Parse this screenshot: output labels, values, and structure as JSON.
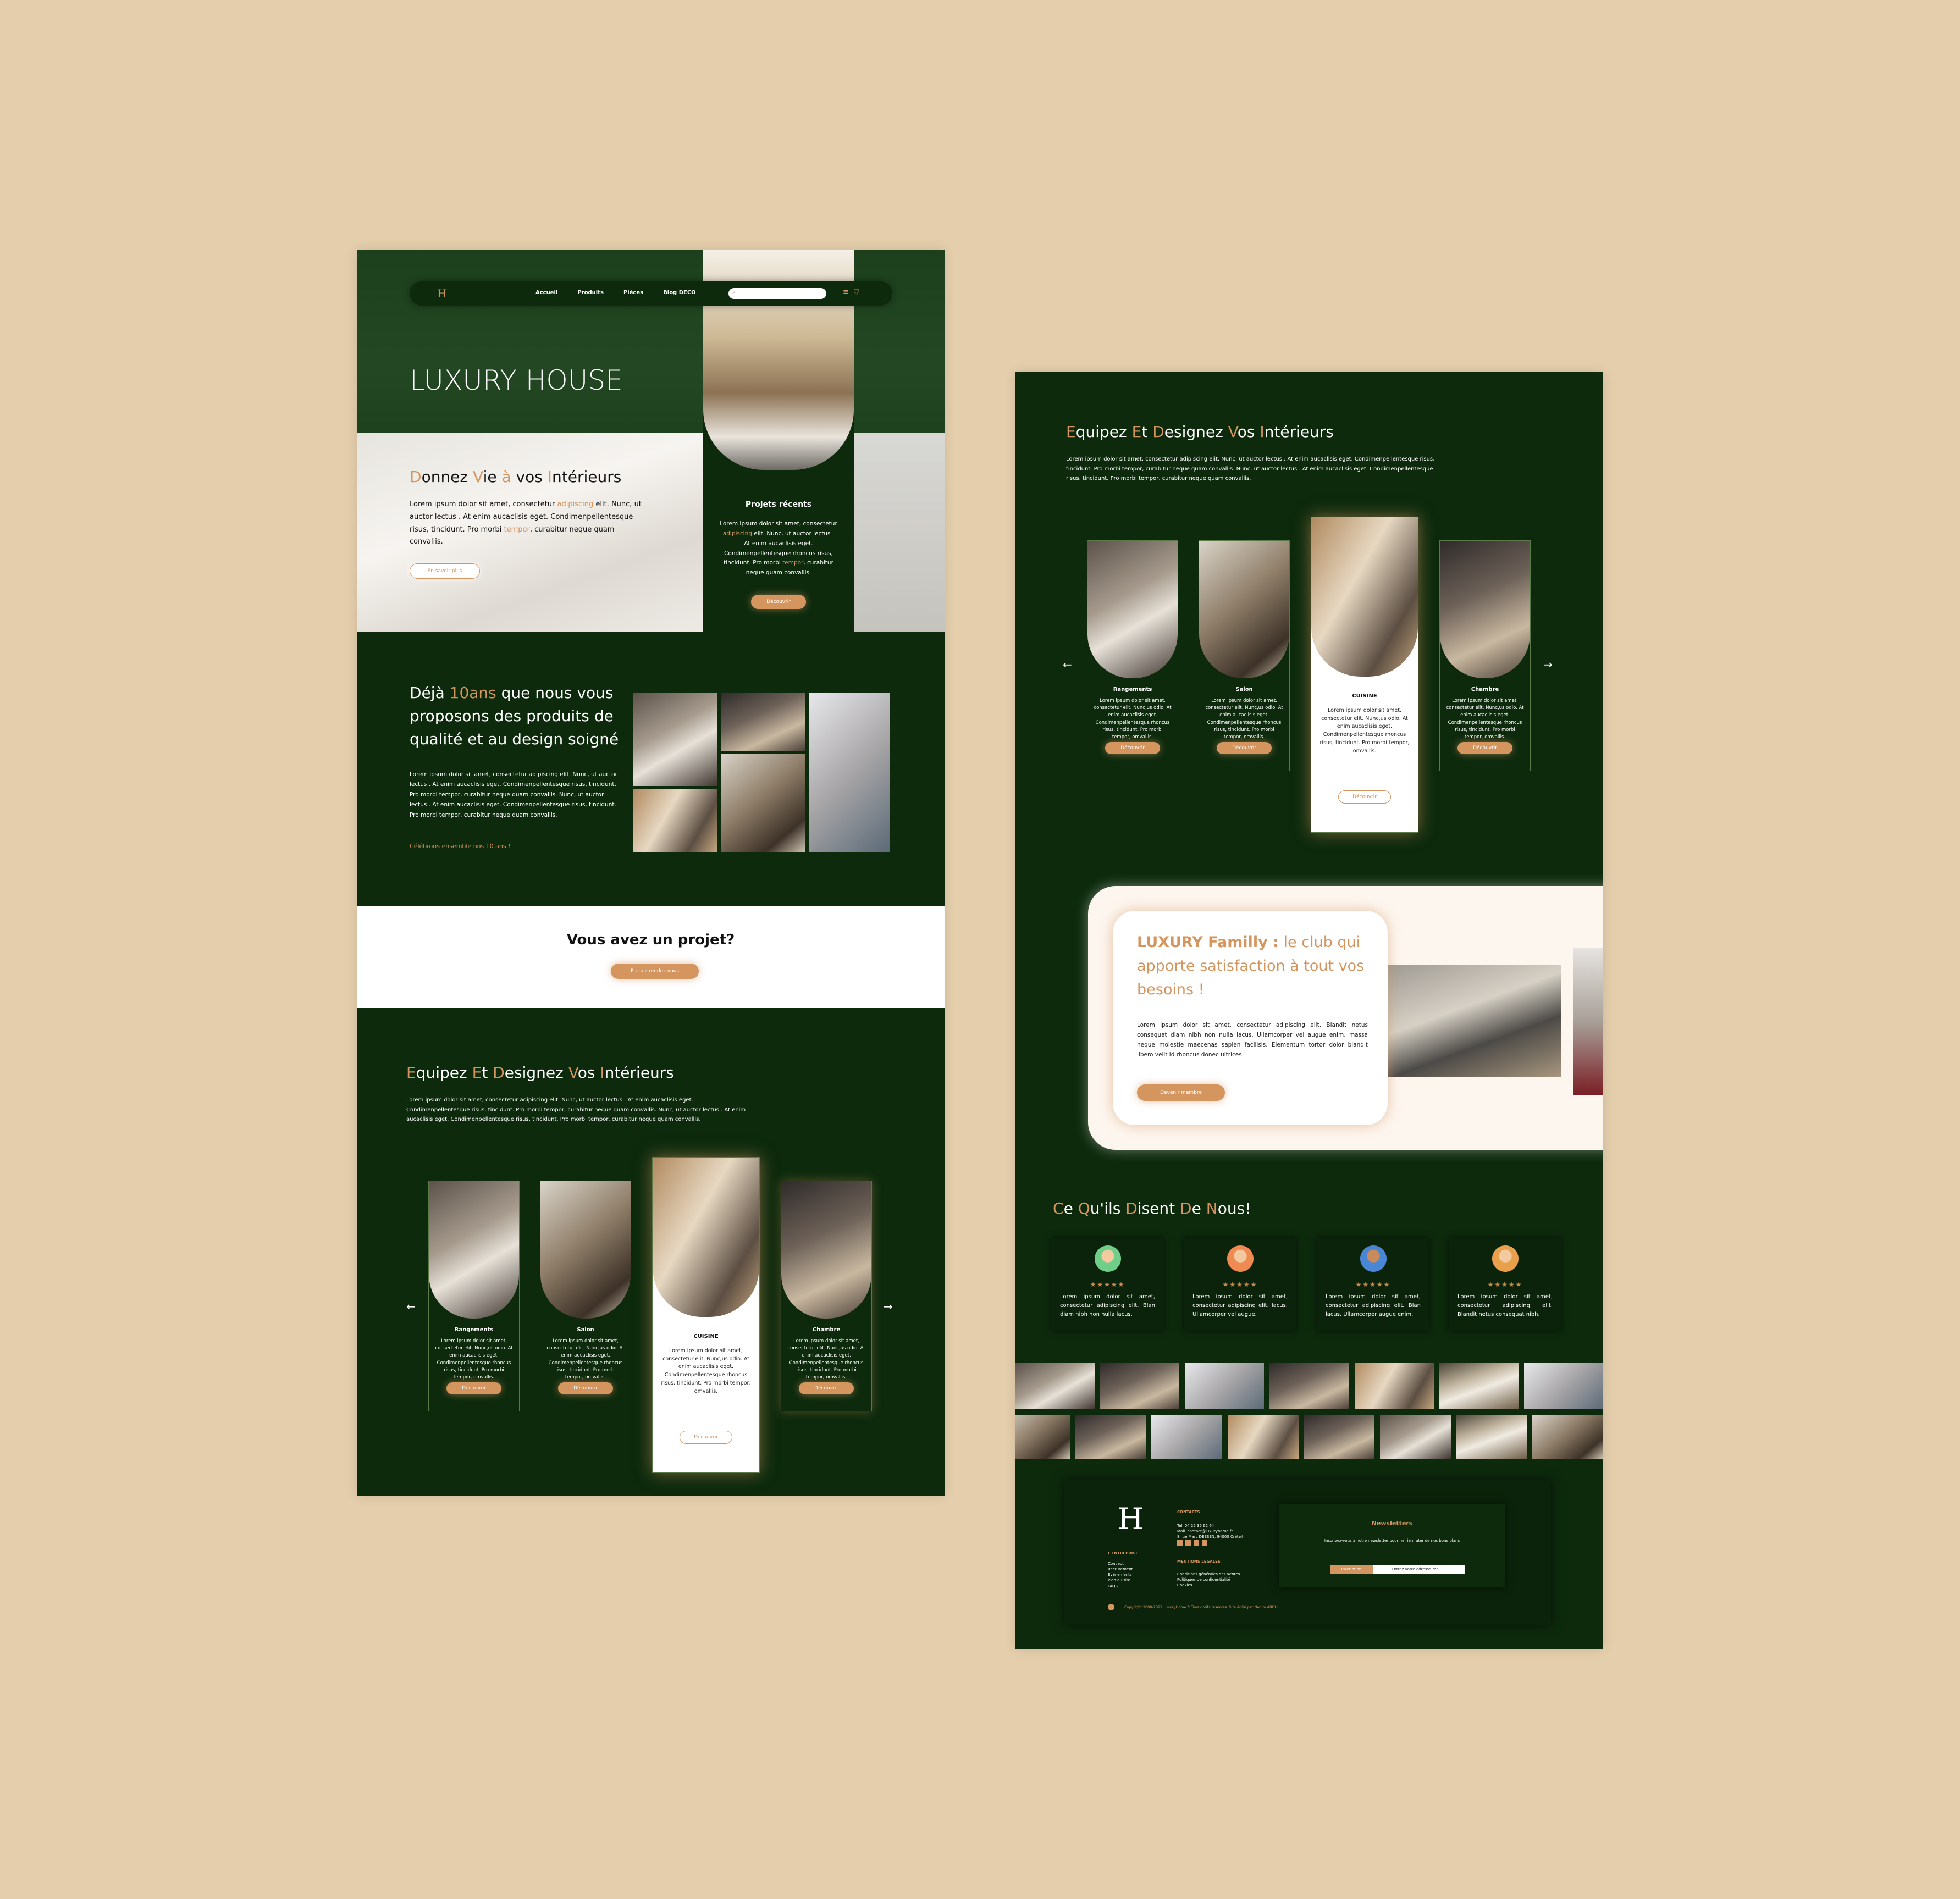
{
  "nav": {
    "items": [
      "Accueil",
      "Produits",
      "Pièces",
      "Blog DECO"
    ],
    "logo": "H"
  },
  "hero": {
    "title": "LUXURY HOUSE",
    "headline_parts": [
      "D",
      "onnez ",
      "V",
      "ie ",
      "à",
      " vos ",
      "I",
      "ntérieurs"
    ],
    "body_before": "Lorem ipsum dolor sit amet, consectetur ",
    "body_hl1": "adipiscing",
    "body_mid": " elit. Nunc, ut auctor lectus . At enim aucaclisis eget. Condimenpellentesque risus, tincidunt. Pro morbi ",
    "body_hl2": "tempor",
    "body_after": ", curabitur neque quam convallis.",
    "cta": "En savoir plus",
    "recent_title": "Projets récents",
    "recent_text_1": "Lorem ipsum dolor sit amet, consectetur ",
    "recent_hl": "adipiscing",
    "recent_text_2": " elit. Nunc, ut auctor lectus . At enim aucaclisis eget. Condimenpellentesque rhoncus risus, tincidunt. Pro morbi ",
    "recent_hl2": "tempor",
    "recent_text_3": ", curabitur neque quam convallis.",
    "recent_cta": "Découvrir"
  },
  "about": {
    "title_1": "Déjà ",
    "title_hl": "10ans",
    "title_2": " que nous vous proposons des produits de qualité et au design soigné",
    "body": "Lorem ipsum dolor sit amet, consectetur adipiscing elit. Nunc, ut auctor lectus . At enim aucaclisis eget. Condimenpellentesque risus, tincidunt. Pro morbi tempor, curabitur neque quam convallis. Nunc, ut auctor lectus . At enim aucaclisis eget. Condimenpellentesque risus, tincidunt. Pro morbi tempor, curabitur neque quam convallis.",
    "link": "Célébrons ensemble nos 10 ans !"
  },
  "project": {
    "title": "Vous avez un projet?",
    "cta": "Prenez rendez-vous"
  },
  "equip": {
    "title_parts": [
      "E",
      "quipez ",
      "E",
      "t ",
      "D",
      "esignez ",
      "V",
      "os ",
      "I",
      "ntérieurs"
    ],
    "body": "Lorem ipsum dolor sit amet, consectetur adipiscing elit. Nunc, ut auctor lectus . At enim aucaclisis eget. Condimenpellentesque risus, tincidunt. Pro morbi tempor, curabitur neque quam convallis. Nunc, ut auctor lectus . At enim aucaclisis eget. Condimenpellentesque risus, tincidunt. Pro morbi tempor, curabitur neque quam convallis.",
    "cards": [
      {
        "title": "Rangements",
        "text": "Lorem ipsum dolor sit amet, consectetur  elit. Nunc,us odio. At enim aucaclisis eget. Condimenpellentesque rhoncus risus, tincidunt. Pro morbi tempor, omvallis.",
        "cta": "Découvrir"
      },
      {
        "title": "Salon",
        "text": "Lorem ipsum dolor sit amet, consectetur  elit. Nunc,us odio. At enim aucaclisis eget. Condimenpellentesque rhoncus risus, tincidunt. Pro morbi tempor, omvallis.",
        "cta": "Découvrir"
      },
      {
        "title": "CUISINE",
        "text": "Lorem ipsum dolor sit amet, consectetur  elit. Nunc,us odio. At enim aucaclisis eget. Condimenpellentesque rhoncus risus, tincidunt. Pro morbi tempor, omvallis.",
        "cta": "Découvrir"
      },
      {
        "title": "Chambre",
        "text": "Lorem ipsum dolor sit amet, consectetur  elit. Nunc,us odio. At enim aucaclisis eget. Condimenpellentesque rhoncus risus, tincidunt. Pro morbi tempor, omvallis.",
        "cta": "Découvrir"
      }
    ],
    "prev": "←",
    "next": "→"
  },
  "club": {
    "title_hl": "LUXURY Familly :",
    "title_rest": " le club qui apporte satisfaction à tout vos besoins !",
    "body": "Lorem ipsum dolor sit amet, consectetur adipiscing elit. Blandit netus consequat diam nibh non nulla lacus. Ullamcorper vel augue enim, massa neque molestie maecenas sapien facilisis. Elementum tortor dolor blandit libero velit id rhoncus donec ultrices.",
    "cta": "Devenir membre"
  },
  "testimonials": {
    "title_parts": [
      "C",
      "e ",
      "Q",
      "u'ils ",
      "D",
      "isent ",
      "D",
      "e ",
      "N",
      "ous!"
    ],
    "items": [
      {
        "stars": "★★★★★",
        "text": "Lorem ipsum dolor sit amet, consectetur adipiscing elit. Blan diam nibh non nulla lacus."
      },
      {
        "stars": "★★★★★",
        "text": "Lorem ipsum dolor sit amet, consectetur adipiscing elit. lacus. Ullamcorper vel augue."
      },
      {
        "stars": "★★★★★",
        "text": "Lorem ipsum dolor sit amet, consectetur adipiscing elit. Blan lacus. Ullamcorper augue enim."
      },
      {
        "stars": "★★★★★",
        "text": "Lorem ipsum dolor sit amet, consectetur adipiscing elit. Blandit netus consequat nibh."
      }
    ]
  },
  "footer": {
    "logo": "H",
    "company_title": "L'ENTREPRISE",
    "company_links": [
      "Concept",
      "Recrutement",
      "Evènements",
      "Plan du site",
      "FAQS"
    ],
    "contacts_title": "CONTACTS",
    "contacts": [
      "Tél. 04 25 35 62 64",
      "Mail. contact@luxuryhome.fr",
      "8 rue Marc DESSEN, 94000 Créteil"
    ],
    "legal_title": "MENTIONS LEGALES",
    "legal": [
      "Conditions générales des ventes",
      "Politiques de confidentialité",
      "Cookies"
    ],
    "newsletter_title": "Newsletters",
    "newsletter_text": "Inscrivez-vous à notre newsletter pour ne rien rater de nos bons plans",
    "newsletter_button": "Inscription",
    "newsletter_placeholder": "Entrez votre adresse mail",
    "copyright": "Copyright 2000-2022 LuxuryHome.fr Tous droits réservés. Site édité par Nadim ABOUI"
  }
}
